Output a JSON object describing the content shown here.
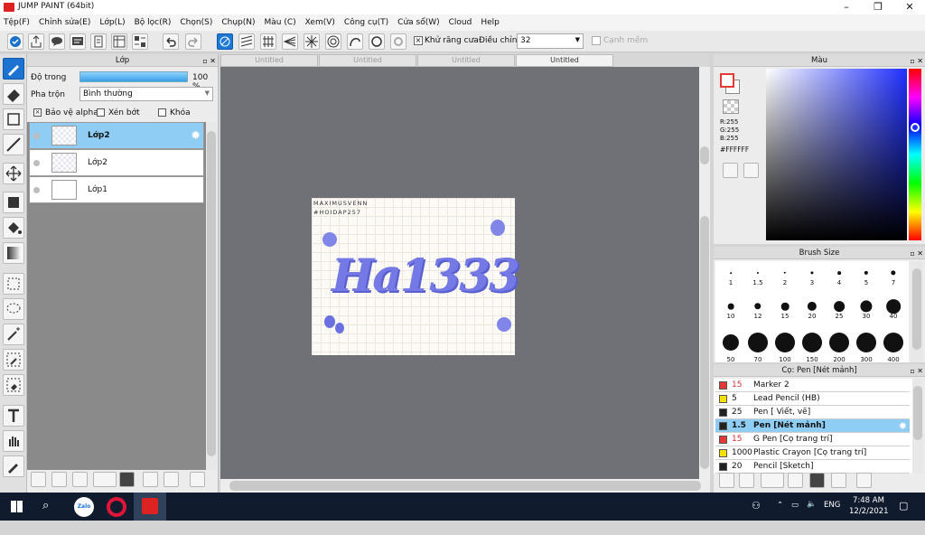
{
  "window": {
    "title": "JUMP PAINT (64bit)"
  },
  "menu": [
    "Tệp(F)",
    "Chỉnh sửa(E)",
    "Lớp(L)",
    "Bộ lọc(R)",
    "Chọn(S)",
    "Chụp(N)",
    "Màu (C)",
    "Xem(V)",
    "Công cụ(T)",
    "Cửa sổ(W)",
    "Cloud",
    "Help"
  ],
  "toolbar": {
    "antialias_label": "Khử răng cưa",
    "adjust_label": "Điều chỉnh",
    "adjust_value": "32",
    "smooth_label": "Cạnh mềm"
  },
  "layer_panel": {
    "title": "Lớp",
    "opacity_label": "Độ trong",
    "opacity_value": "100 %",
    "opacity_fraction": 1.0,
    "blend_label": "Pha trộn",
    "blend_value": "Bình thường",
    "protect_alpha": "Bảo vệ alpha",
    "clipping": "Xén bớt",
    "lock": "Khóa",
    "layers": [
      {
        "name": "Lớp2",
        "selected": true
      },
      {
        "name": "Lớp2",
        "selected": false
      },
      {
        "name": "Lớp1",
        "selected": false
      }
    ]
  },
  "canvas": {
    "tabs": [
      "Untitled",
      "Untitled",
      "Untitled",
      "Untitled"
    ],
    "active_tab": 3,
    "artwork": {
      "small_text_1": "MAXIMUSVENN",
      "small_text_2": "#HOIDAP257",
      "main_text": "Ha1333"
    }
  },
  "color_panel": {
    "title": "Màu",
    "r": "R:255",
    "g": "G:255",
    "b": "B:255",
    "hex": "#FFFFFF",
    "foreground_color": "#e53935",
    "background_color": "#ffffff"
  },
  "brush_size_panel": {
    "title": "Brush Size",
    "sizes": [
      "1",
      "1.5",
      "2",
      "3",
      "4",
      "5",
      "7",
      "10",
      "12",
      "15",
      "20",
      "25",
      "30",
      "40",
      "50",
      "70",
      "100",
      "150",
      "200",
      "300",
      "400"
    ]
  },
  "pen_panel": {
    "title": "Cọ: Pen [Nét mảnh]",
    "items": [
      {
        "color": "#e53935",
        "size": "15",
        "name": "Marker 2",
        "selected": false
      },
      {
        "color": "#f5e000",
        "size": "5",
        "name": "Lead Pencil (HB)",
        "selected": false
      },
      {
        "color": "#222222",
        "size": "25",
        "name": "Pen [ Viết, vẽ]",
        "selected": false
      },
      {
        "color": "#222222",
        "size": "1.5",
        "name": "Pen [Nét mảnh]",
        "selected": true
      },
      {
        "color": "#e53935",
        "size": "15",
        "name": "G Pen [Cọ trang trí]",
        "selected": false
      },
      {
        "color": "#f5e000",
        "size": "1000",
        "name": "Plastic Crayon [Cọ trang trí]",
        "selected": false
      },
      {
        "color": "#222222",
        "size": "20",
        "name": "Pencil [Sketch]",
        "selected": false
      }
    ]
  },
  "taskbar": {
    "zalo_label": "Zalo",
    "lang": "ENG",
    "time": "7:48 AM",
    "date": "12/2/2021"
  }
}
